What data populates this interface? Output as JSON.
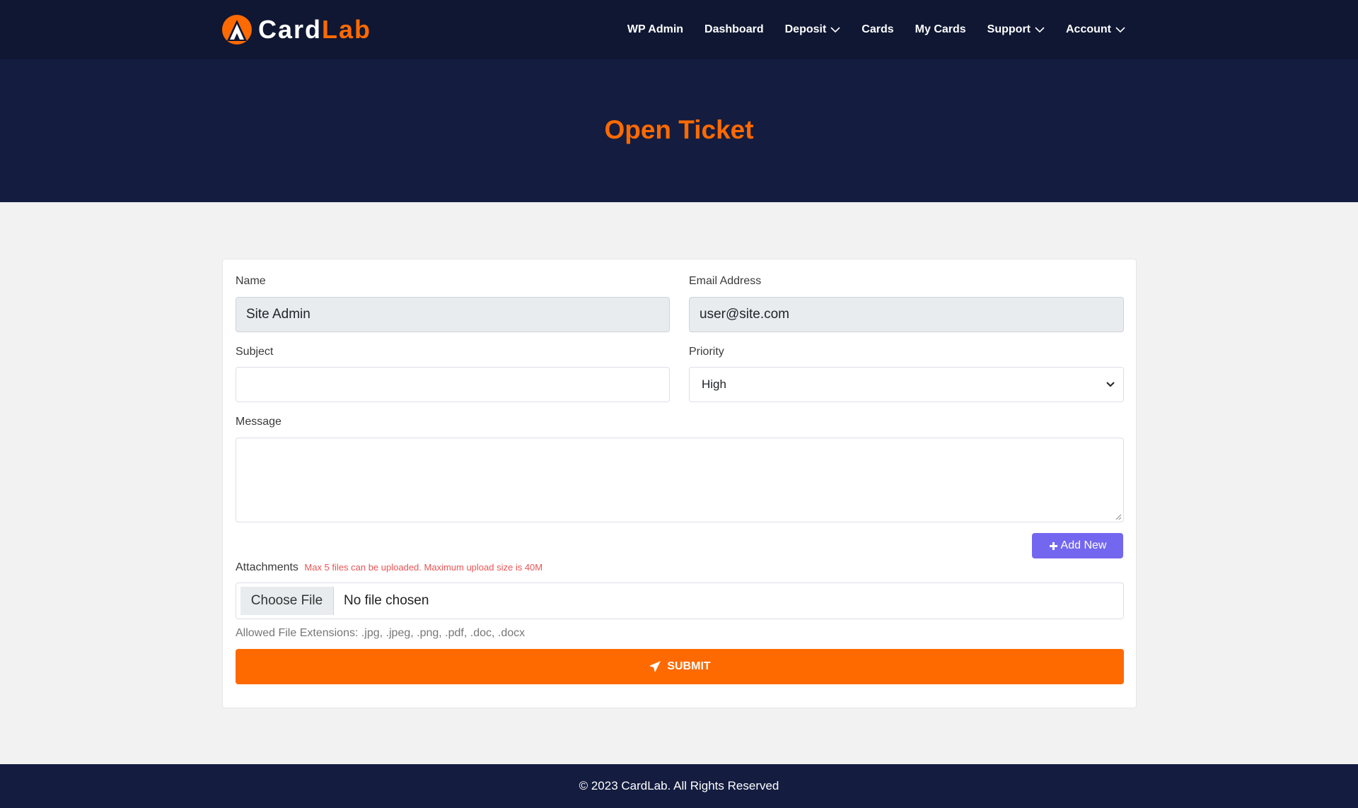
{
  "brand": {
    "part1": "Card",
    "part2": "Lab",
    "accent": "#ff6a00",
    "dark": "#0f1733"
  },
  "nav": {
    "items": [
      {
        "label": "WP Admin",
        "dropdown": false
      },
      {
        "label": "Dashboard",
        "dropdown": false
      },
      {
        "label": "Deposit",
        "dropdown": true
      },
      {
        "label": "Cards",
        "dropdown": false
      },
      {
        "label": "My Cards",
        "dropdown": false
      },
      {
        "label": "Support",
        "dropdown": true
      },
      {
        "label": "Account",
        "dropdown": true
      }
    ]
  },
  "hero": {
    "title": "Open Ticket"
  },
  "form": {
    "name_label": "Name",
    "name_value": "Site Admin",
    "email_label": "Email Address",
    "email_value": "user@site.com",
    "subject_label": "Subject",
    "subject_value": "",
    "priority_label": "Priority",
    "priority_value": "High",
    "message_label": "Message",
    "message_value": "",
    "add_new_label": "Add New",
    "attachments_label": "Attachments",
    "attachments_note": "Max 5 files can be uploaded. Maximum upload size is 40M",
    "choose_file_label": "Choose File",
    "file_status": "No file chosen",
    "allowed_extensions": "Allowed File Extensions: .jpg, .jpeg, .png, .pdf, .doc, .docx",
    "submit_label": "SUBMIT"
  },
  "icons": {
    "logo": "logo-mark-icon",
    "dropdown": "chevron-down-icon",
    "add": "plus-icon",
    "submit": "paper-plane-icon"
  },
  "footer": {
    "text": "© 2023 CardLab. All Rights Reserved"
  }
}
